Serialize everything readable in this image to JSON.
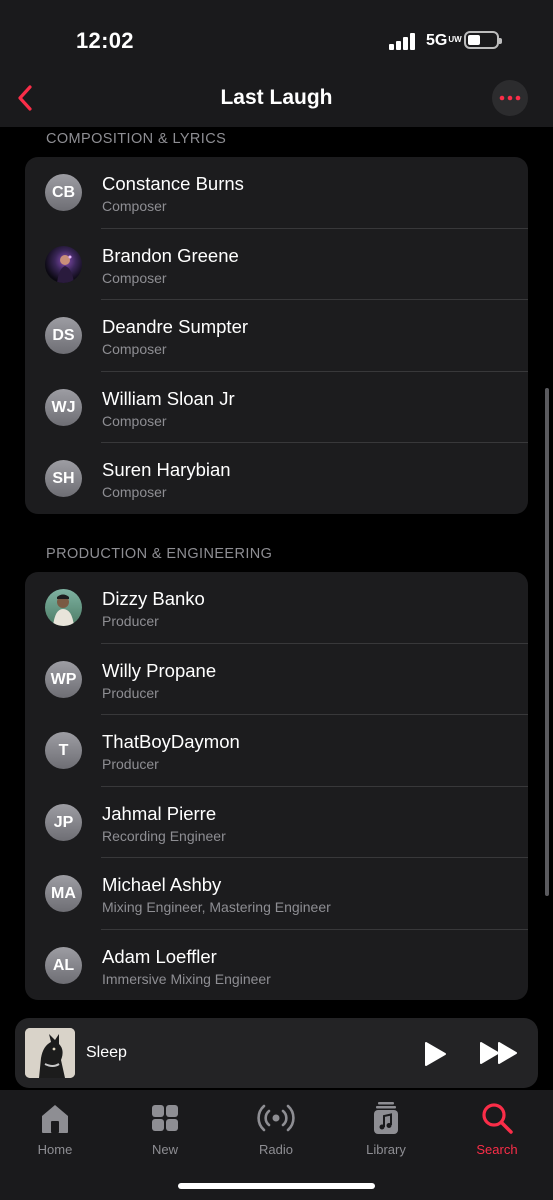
{
  "status_bar": {
    "time": "12:02",
    "network": "5G",
    "network_sub": "UW"
  },
  "nav": {
    "title": "Last Laugh"
  },
  "sections": [
    {
      "title": "COMPOSITION & LYRICS",
      "people": [
        {
          "initials": "CB",
          "name": "Constance Burns",
          "role": "Composer"
        },
        {
          "initials": "",
          "name": "Brandon Greene",
          "role": "Composer",
          "photo": true
        },
        {
          "initials": "DS",
          "name": "Deandre Sumpter",
          "role": "Composer"
        },
        {
          "initials": "WJ",
          "name": "William Sloan Jr",
          "role": "Composer"
        },
        {
          "initials": "SH",
          "name": "Suren Harybian",
          "role": "Composer"
        }
      ]
    },
    {
      "title": "PRODUCTION & ENGINEERING",
      "people": [
        {
          "initials": "",
          "name": "Dizzy Banko",
          "role": "Producer",
          "photo": true
        },
        {
          "initials": "WP",
          "name": "Willy Propane",
          "role": "Producer"
        },
        {
          "initials": "T",
          "name": "ThatBoyDaymon",
          "role": "Producer"
        },
        {
          "initials": "JP",
          "name": "Jahmal Pierre",
          "role": "Recording Engineer"
        },
        {
          "initials": "MA",
          "name": "Michael Ashby",
          "role": "Mixing Engineer, Mastering Engineer"
        },
        {
          "initials": "AL",
          "name": "Adam Loeffler",
          "role": "Immersive Mixing Engineer"
        }
      ]
    }
  ],
  "mini_player": {
    "title": "Sleep"
  },
  "tabs": [
    {
      "label": "Home",
      "icon": "home-icon"
    },
    {
      "label": "New",
      "icon": "grid-icon"
    },
    {
      "label": "Radio",
      "icon": "radio-icon"
    },
    {
      "label": "Library",
      "icon": "library-icon"
    },
    {
      "label": "Search",
      "icon": "search-icon",
      "active": true
    }
  ],
  "colors": {
    "accent": "#fa2d48",
    "background": "#000000",
    "card": "#1c1c1e",
    "secondary_text": "#8e8e93"
  }
}
